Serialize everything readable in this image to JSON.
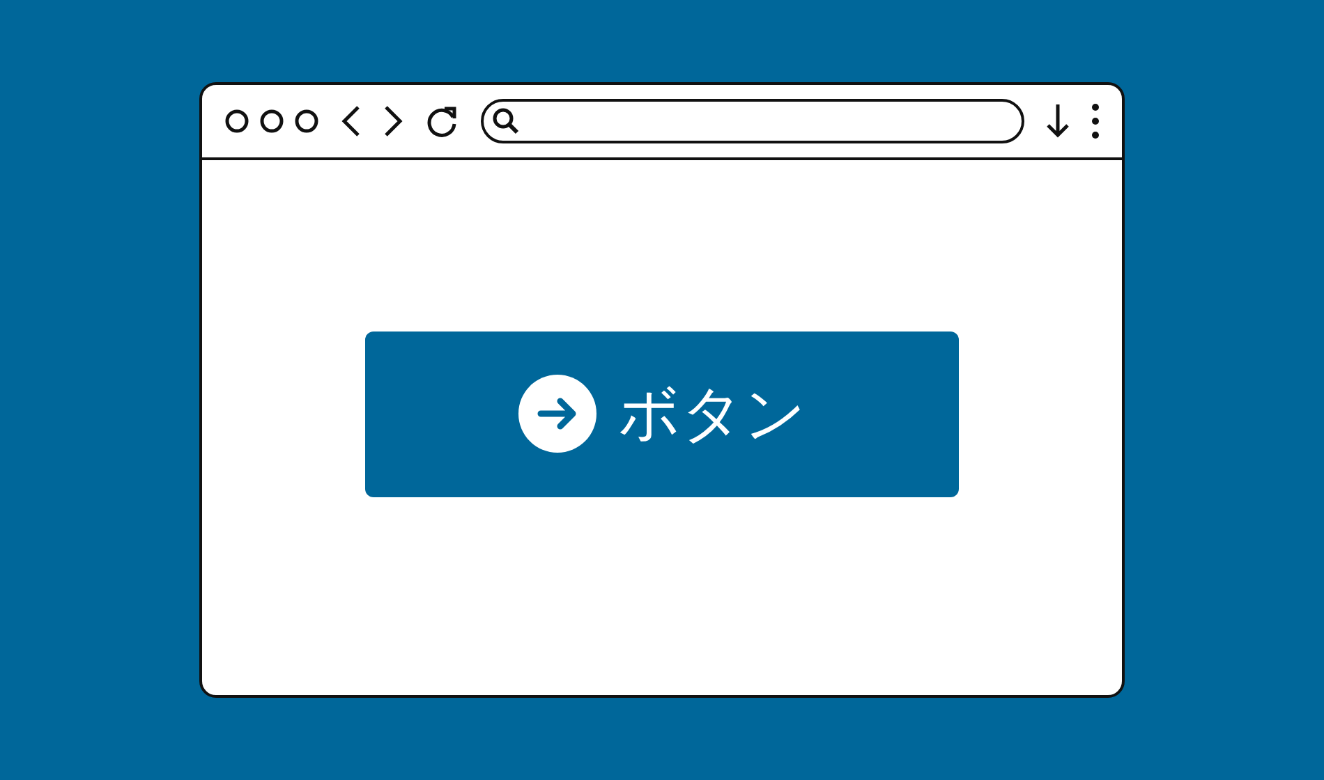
{
  "button": {
    "label": "ボタン"
  }
}
